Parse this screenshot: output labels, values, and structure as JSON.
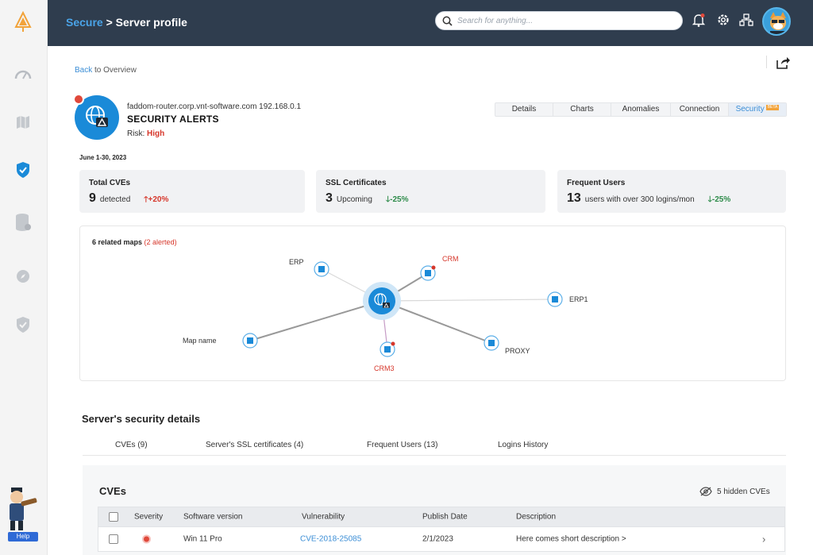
{
  "header": {
    "crumb_root": "Secure",
    "crumb_sep": " > ",
    "crumb_page": "Server profile",
    "search_placeholder": "Search for anything..."
  },
  "sidebar": {
    "items": [
      "dashboard",
      "map",
      "security",
      "database",
      "explore",
      "shield"
    ],
    "help_label": "Help"
  },
  "back": {
    "link": "Back",
    "to": "to",
    "target": "Overview"
  },
  "server": {
    "host": "faddom-router.corp.vnt-software.com 192.168.0.1",
    "title": "SECURITY ALERTS",
    "risk_label": "Risk:",
    "risk_value": "High"
  },
  "tabs": [
    {
      "label": "Details"
    },
    {
      "label": "Charts"
    },
    {
      "label": "Anomalies"
    },
    {
      "label": "Connection"
    },
    {
      "label": "Security",
      "badge": "BETA",
      "active": true
    }
  ],
  "date_range": "June 1-30, 2023",
  "cards": [
    {
      "title": "Total CVEs",
      "number": "9",
      "text": "detected",
      "trend": "+20%",
      "direction": "up"
    },
    {
      "title": "SSL Certificates",
      "number": "3",
      "text": "Upcoming",
      "trend": "-25%",
      "direction": "down"
    },
    {
      "title": "Frequent Users",
      "number": "13",
      "text": "users with over 300 logins/mon",
      "trend": "-25%",
      "direction": "down"
    }
  ],
  "map": {
    "title": "6 related maps",
    "alerted": "(2 alerted)",
    "nodes": [
      {
        "label": "ERP",
        "alert": false
      },
      {
        "label": "CRM",
        "alert": true
      },
      {
        "label": "ERP1",
        "alert": false
      },
      {
        "label": "Map name",
        "alert": false
      },
      {
        "label": "CRM3",
        "alert": true
      },
      {
        "label": "PROXY",
        "alert": false
      }
    ]
  },
  "details": {
    "title": "Server's security  details",
    "sub_tabs": [
      "CVEs (9)",
      "Server's SSL certificates (4)",
      "Frequent Users (13)",
      "Logins History"
    ]
  },
  "cves": {
    "title": "CVEs",
    "hidden": "5 hidden CVEs",
    "columns": [
      "Severity",
      "Software version",
      "Vulnerability",
      "Publish Date",
      "Description"
    ],
    "rows": [
      {
        "severity": "high",
        "software": "Win 11 Pro",
        "vulnerability": "CVE-2018-25085",
        "date": "2/1/2023",
        "description": "Here comes short description >"
      }
    ]
  },
  "colors": {
    "accent": "#3b8ed6",
    "header_bg": "#2f3d4e",
    "alert": "#d6362a",
    "positive": "#2e8b4a"
  }
}
